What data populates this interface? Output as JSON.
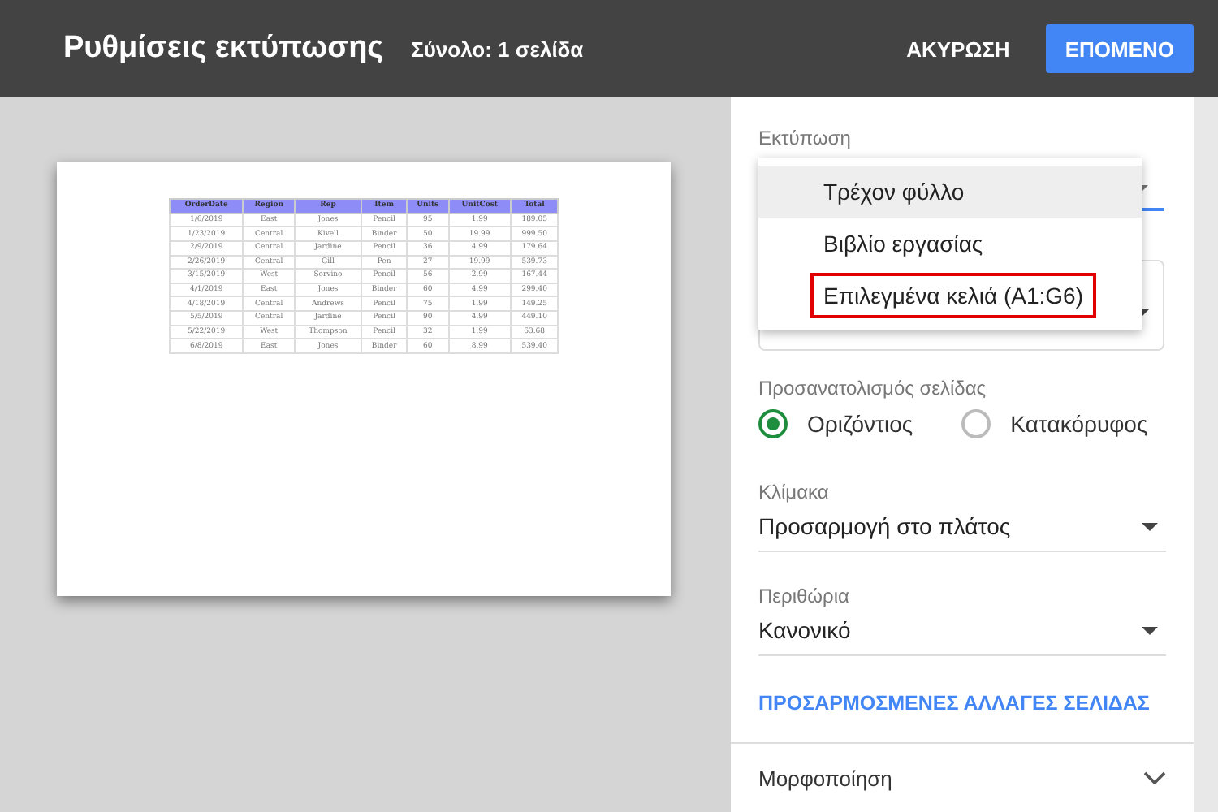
{
  "header": {
    "title": "Ρυθμίσεις εκτύπωσης",
    "subtitle": "Σύνολο: 1 σελίδα",
    "cancel": "ΑΚΥΡΩΣΗ",
    "next": "ΕΠΟΜΕΝΟ"
  },
  "preview": {
    "columns": [
      "OrderDate",
      "Region",
      "Rep",
      "Item",
      "Units",
      "UnitCost",
      "Total"
    ],
    "rows": [
      [
        "1/6/2019",
        "East",
        "Jones",
        "Pencil",
        "95",
        "1.99",
        "189.05"
      ],
      [
        "1/23/2019",
        "Central",
        "Kivell",
        "Binder",
        "50",
        "19.99",
        "999.50"
      ],
      [
        "2/9/2019",
        "Central",
        "Jardine",
        "Pencil",
        "36",
        "4.99",
        "179.64"
      ],
      [
        "2/26/2019",
        "Central",
        "Gill",
        "Pen",
        "27",
        "19.99",
        "539.73"
      ],
      [
        "3/15/2019",
        "West",
        "Sorvino",
        "Pencil",
        "56",
        "2.99",
        "167.44"
      ],
      [
        "4/1/2019",
        "East",
        "Jones",
        "Binder",
        "60",
        "4.99",
        "299.40"
      ],
      [
        "4/18/2019",
        "Central",
        "Andrews",
        "Pencil",
        "75",
        "1.99",
        "149.25"
      ],
      [
        "5/5/2019",
        "Central",
        "Jardine",
        "Pencil",
        "90",
        "4.99",
        "449.10"
      ],
      [
        "5/22/2019",
        "West",
        "Thompson",
        "Pencil",
        "32",
        "1.99",
        "63.68"
      ],
      [
        "6/8/2019",
        "East",
        "Jones",
        "Binder",
        "60",
        "8.99",
        "539.40"
      ]
    ]
  },
  "print_label": "Εκτύπωση",
  "print_menu": [
    {
      "label": "Τρέχον φύλλο",
      "selected": true,
      "outlined": false
    },
    {
      "label": "Βιβλίο εργασίας",
      "selected": false,
      "outlined": false
    },
    {
      "label": "Επιλεγμένα κελιά (A1:G6)",
      "selected": false,
      "outlined": true
    }
  ],
  "orientation": {
    "label": "Προσανατολισμός σελίδας",
    "options": [
      {
        "label": "Οριζόντιος",
        "selected": true
      },
      {
        "label": "Κατακόρυφος",
        "selected": false
      }
    ]
  },
  "scale": {
    "label": "Κλίμακα",
    "value": "Προσαρμογή στο πλάτος"
  },
  "margins": {
    "label": "Περιθώρια",
    "value": "Κανονικό"
  },
  "custom_link": "ΠΡΟΣΑΡΜΟΣΜΕΝΕΣ ΑΛΛΑΓΕΣ ΣΕΛΙΔΑΣ",
  "formatting": {
    "label": "Μορφοποίηση",
    "expanded": false
  }
}
